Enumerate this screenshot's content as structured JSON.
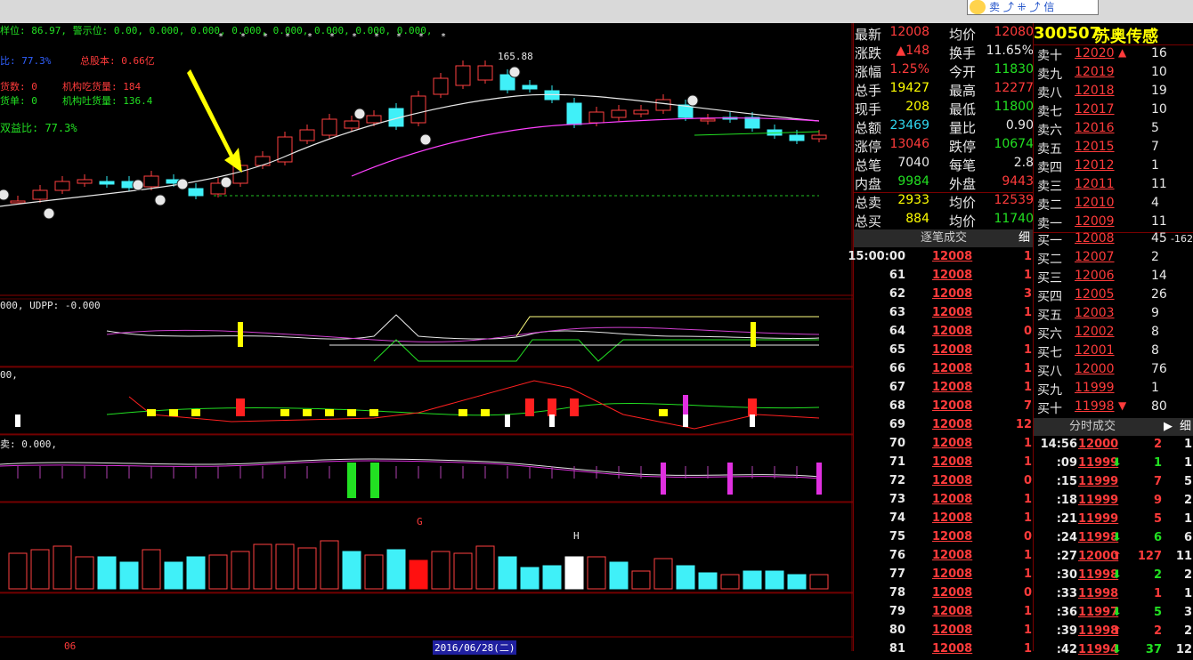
{
  "toolbar": {
    "button_label": "卖 ⤴ ⁜ ⤴ 信"
  },
  "overlays": {
    "main_line1": "样位: 86.97, 警示位: 0.00, 0.000, 0.000, 0.000, 0.000, 0.000, 0.000, 0.000,",
    "main_ratio": "比: 77.3%",
    "main_total_shares": "总股本: 0.66亿",
    "main_buy_count": "货数: 0",
    "main_inst_in": "机构吃货量: 184",
    "main_sell_count": "货单: 0",
    "main_inst_out": "机构吐货量: 136.4",
    "main_profit_ratio": "双益比: 77.3%",
    "price_peak_label": "165.88",
    "ind1_label": "000, UDPP: -0.000",
    "ind2_label": "00,",
    "ind3_label": "卖: 0.000,",
    "vol_label_g": "G",
    "vol_label_h": "H",
    "date_label_06": "06",
    "date_cursor": "2016/06/28(二)"
  },
  "stock": {
    "code": "300507",
    "name": "苏奥传感"
  },
  "quote_rows": [
    {
      "l": "最新",
      "lv": "12008",
      "r": "均价",
      "rv": "12080",
      "lc": "red",
      "rc": "red"
    },
    {
      "l": "涨跌",
      "lv": "▲148",
      "r": "换手",
      "rv": "11.65%",
      "lc": "red",
      "rc": "wht"
    },
    {
      "l": "涨幅",
      "lv": "1.25%",
      "r": "今开",
      "rv": "11830",
      "lc": "red",
      "rc": "grn"
    },
    {
      "l": "总手",
      "lv": "19427",
      "r": "最高",
      "rv": "12277",
      "lc": "yel",
      "rc": "red"
    },
    {
      "l": "现手",
      "lv": "208",
      "r": "最低",
      "rv": "11800",
      "lc": "yel",
      "rc": "grn"
    },
    {
      "l": "总额",
      "lv": "23469",
      "r": "量比",
      "rv": "0.90",
      "lc": "cyan",
      "rc": "wht"
    },
    {
      "l": "涨停",
      "lv": "13046",
      "r": "跌停",
      "rv": "10674",
      "lc": "red",
      "rc": "grn"
    },
    {
      "l": "总笔",
      "lv": "7040",
      "r": "每笔",
      "rv": "2.8",
      "lc": "wht",
      "rc": "wht"
    },
    {
      "l": "内盘",
      "lv": "9984",
      "r": "外盘",
      "rv": "9443",
      "lc": "grn",
      "rc": "red"
    },
    {
      "l": "总卖",
      "lv": "2933",
      "r": "均价",
      "rv": "12539",
      "lc": "yel",
      "rc": "red"
    },
    {
      "l": "总买",
      "lv": "884",
      "r": "均价",
      "rv": "11740",
      "lc": "yel",
      "rc": "grn"
    }
  ],
  "tick_header": {
    "title": "逐笔成交",
    "btn": "细"
  },
  "ticks": [
    {
      "t": "15:00:00",
      "p": "12008",
      "v": "1"
    },
    {
      "t": "61",
      "p": "12008",
      "v": "1"
    },
    {
      "t": "62",
      "p": "12008",
      "v": "3"
    },
    {
      "t": "63",
      "p": "12008",
      "v": "1"
    },
    {
      "t": "64",
      "p": "12008",
      "v": "0"
    },
    {
      "t": "65",
      "p": "12008",
      "v": "1"
    },
    {
      "t": "66",
      "p": "12008",
      "v": "1"
    },
    {
      "t": "67",
      "p": "12008",
      "v": "1"
    },
    {
      "t": "68",
      "p": "12008",
      "v": "7"
    },
    {
      "t": "69",
      "p": "12008",
      "v": "12"
    },
    {
      "t": "70",
      "p": "12008",
      "v": "1"
    },
    {
      "t": "71",
      "p": "12008",
      "v": "1"
    },
    {
      "t": "72",
      "p": "12008",
      "v": "0"
    },
    {
      "t": "73",
      "p": "12008",
      "v": "1"
    },
    {
      "t": "74",
      "p": "12008",
      "v": "1"
    },
    {
      "t": "75",
      "p": "12008",
      "v": "0"
    },
    {
      "t": "76",
      "p": "12008",
      "v": "1"
    },
    {
      "t": "77",
      "p": "12008",
      "v": "1"
    },
    {
      "t": "78",
      "p": "12008",
      "v": "0"
    },
    {
      "t": "79",
      "p": "12008",
      "v": "1"
    },
    {
      "t": "80",
      "p": "12008",
      "v": "1"
    },
    {
      "t": "81",
      "p": "12008",
      "v": "1"
    }
  ],
  "asks": [
    {
      "l": "卖十",
      "p": "12020",
      "a": "▲",
      "v": "16"
    },
    {
      "l": "卖九",
      "p": "12019",
      "a": "",
      "v": "10"
    },
    {
      "l": "卖八",
      "p": "12018",
      "a": "",
      "v": "19"
    },
    {
      "l": "卖七",
      "p": "12017",
      "a": "",
      "v": "10"
    },
    {
      "l": "卖六",
      "p": "12016",
      "a": "",
      "v": "5"
    },
    {
      "l": "卖五",
      "p": "12015",
      "a": "",
      "v": "7"
    },
    {
      "l": "卖四",
      "p": "12012",
      "a": "",
      "v": "1"
    },
    {
      "l": "卖三",
      "p": "12011",
      "a": "",
      "v": "11"
    },
    {
      "l": "卖二",
      "p": "12010",
      "a": "",
      "v": "4"
    },
    {
      "l": "卖一",
      "p": "12009",
      "a": "",
      "v": "11"
    }
  ],
  "bids": [
    {
      "l": "买一",
      "p": "12008",
      "a": "",
      "v": "45",
      "x": "-162"
    },
    {
      "l": "买二",
      "p": "12007",
      "a": "",
      "v": "2",
      "x": ""
    },
    {
      "l": "买三",
      "p": "12006",
      "a": "",
      "v": "14",
      "x": ""
    },
    {
      "l": "买四",
      "p": "12005",
      "a": "",
      "v": "26",
      "x": ""
    },
    {
      "l": "买五",
      "p": "12003",
      "a": "",
      "v": "9",
      "x": ""
    },
    {
      "l": "买六",
      "p": "12002",
      "a": "",
      "v": "8",
      "x": ""
    },
    {
      "l": "买七",
      "p": "12001",
      "a": "",
      "v": "8",
      "x": ""
    },
    {
      "l": "买八",
      "p": "12000",
      "a": "",
      "v": "76",
      "x": ""
    },
    {
      "l": "买九",
      "p": "11999",
      "a": "",
      "v": "1",
      "x": ""
    },
    {
      "l": "买十",
      "p": "11998",
      "a": "▼",
      "v": "80",
      "x": ""
    }
  ],
  "split_header": {
    "title": "分时成交",
    "btn1": "▶",
    "btn2": "细"
  },
  "splits": [
    {
      "t": "14:56",
      "p": "12000",
      "a": "",
      "v": "2",
      "n": "1",
      "c": "red"
    },
    {
      "t": ":09",
      "p": "11999",
      "a": "⬇",
      "v": "1",
      "n": "1",
      "c": "grn"
    },
    {
      "t": ":15",
      "p": "11999",
      "a": "",
      "v": "7",
      "n": "5",
      "c": "red"
    },
    {
      "t": ":18",
      "p": "11999",
      "a": "",
      "v": "9",
      "n": "2",
      "c": "red"
    },
    {
      "t": ":21",
      "p": "11999",
      "a": "",
      "v": "5",
      "n": "1",
      "c": "red"
    },
    {
      "t": ":24",
      "p": "11998",
      "a": "⬇",
      "v": "6",
      "n": "6",
      "c": "grn"
    },
    {
      "t": ":27",
      "p": "12000",
      "a": "⬆",
      "v": "127",
      "n": "11",
      "c": "red"
    },
    {
      "t": ":30",
      "p": "11998",
      "a": "⬇",
      "v": "2",
      "n": "2",
      "c": "grn"
    },
    {
      "t": ":33",
      "p": "11998",
      "a": "",
      "v": "1",
      "n": "1",
      "c": "red"
    },
    {
      "t": ":36",
      "p": "11997",
      "a": "⬇",
      "v": "5",
      "n": "3",
      "c": "grn"
    },
    {
      "t": ":39",
      "p": "11998",
      "a": "⬆",
      "v": "2",
      "n": "2",
      "c": "red"
    },
    {
      "t": ":42",
      "p": "11994",
      "a": "⬇",
      "v": "37",
      "n": "12",
      "c": "grn"
    }
  ]
}
